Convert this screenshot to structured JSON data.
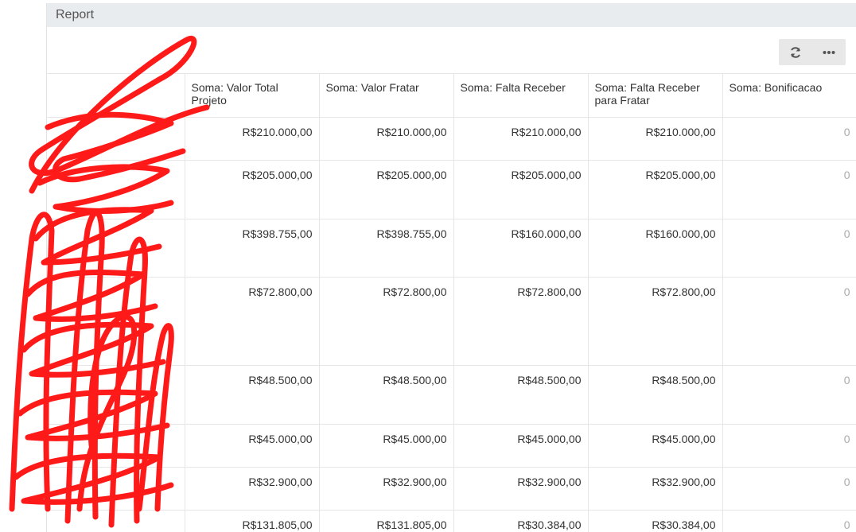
{
  "panel": {
    "title": "Report"
  },
  "toolbar": {
    "refresh_icon": "refresh-icon",
    "more_icon": "more-icon"
  },
  "table": {
    "columns": [
      "",
      "Soma: Valor Total Projeto",
      "Soma: Valor Fratar",
      "Soma: Falta Receber",
      "Soma: Falta Receber para Fratar",
      "Soma: Bonificacao"
    ],
    "rows": [
      {
        "name": "",
        "values": [
          "R$210.000,00",
          "R$210.000,00",
          "R$210.000,00",
          "R$210.000,00",
          "0"
        ]
      },
      {
        "name": "",
        "values": [
          "R$205.000,00",
          "R$205.000,00",
          "R$205.000,00",
          "R$205.000,00",
          "0"
        ]
      },
      {
        "name": "",
        "values": [
          "R$398.755,00",
          "R$398.755,00",
          "R$160.000,00",
          "R$160.000,00",
          "0"
        ]
      },
      {
        "name": "",
        "values": [
          "R$72.800,00",
          "R$72.800,00",
          "R$72.800,00",
          "R$72.800,00",
          "0"
        ]
      },
      {
        "name": "",
        "values": [
          "R$48.500,00",
          "R$48.500,00",
          "R$48.500,00",
          "R$48.500,00",
          "0"
        ]
      },
      {
        "name": "",
        "values": [
          "R$45.000,00",
          "R$45.000,00",
          "R$45.000,00",
          "R$45.000,00",
          "0"
        ]
      },
      {
        "name": "",
        "values": [
          "R$32.900,00",
          "R$32.900,00",
          "R$32.900,00",
          "R$32.900,00",
          "0"
        ]
      },
      {
        "name": "",
        "values": [
          "R$131.805,00",
          "R$131.805,00",
          "R$30.384,00",
          "R$30.384,00",
          "0"
        ]
      }
    ]
  },
  "colors": {
    "header_bg": "#e9ecee",
    "link": "#3a73b3",
    "redaction": "#ff0000"
  }
}
